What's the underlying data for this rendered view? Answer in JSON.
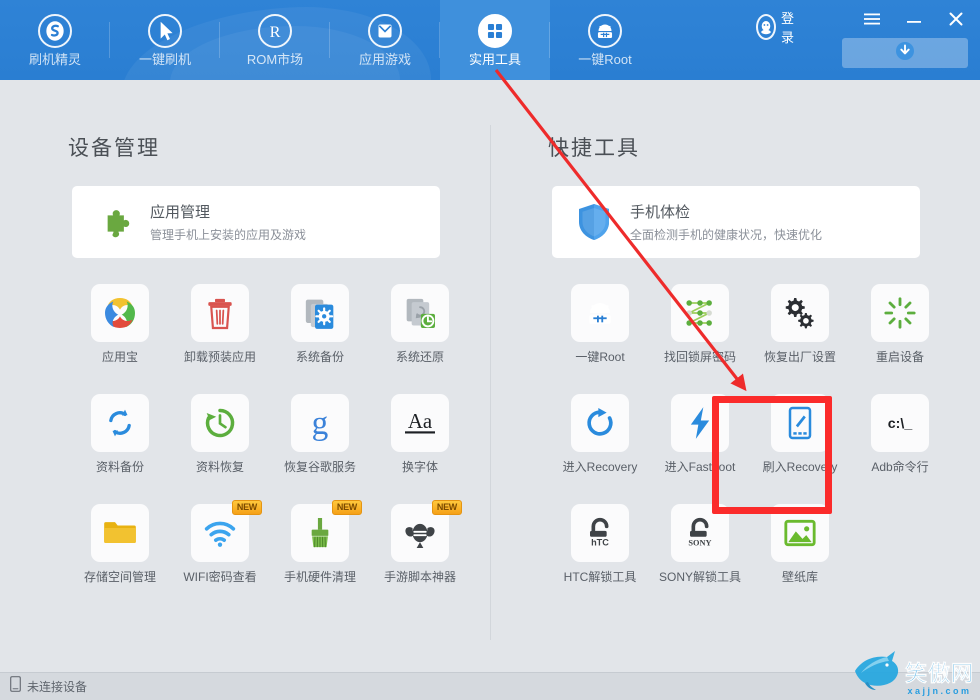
{
  "header": {
    "nav": [
      {
        "label": "刷机精灵",
        "icon": "flash-genie-icon",
        "active": false
      },
      {
        "label": "一键刷机",
        "icon": "cursor-arrow-icon",
        "active": false
      },
      {
        "label": "ROM市场",
        "icon": "rom-market-icon",
        "active": false
      },
      {
        "label": "应用游戏",
        "icon": "app-game-icon",
        "active": false
      },
      {
        "label": "实用工具",
        "icon": "grid-tools-icon",
        "active": true
      },
      {
        "label": "一键Root",
        "icon": "android-root-icon",
        "active": false
      }
    ],
    "login_label": "登录",
    "login_icon": "penguin-avatar-icon",
    "menu_icon": "hamburger-menu-icon",
    "minimize_icon": "minimize-icon",
    "close_icon": "close-icon",
    "download_icon": "download-arrow-icon"
  },
  "left": {
    "section_title": "设备管理",
    "feature": {
      "title": "应用管理",
      "subtitle": "管理手机上安装的应用及游戏",
      "icon": "puzzle-piece-icon"
    },
    "tiles": [
      {
        "label": "应用宝",
        "icon": "yingyongbao-icon",
        "new": false
      },
      {
        "label": "卸载预装应用",
        "icon": "trash-can-icon",
        "new": false
      },
      {
        "label": "系统备份",
        "icon": "system-backup-icon",
        "new": false
      },
      {
        "label": "系统还原",
        "icon": "system-restore-icon",
        "new": false
      },
      {
        "label": "资料备份",
        "icon": "data-backup-sync-icon",
        "new": false
      },
      {
        "label": "资料恢复",
        "icon": "data-restore-clock-icon",
        "new": false
      },
      {
        "label": "恢复谷歌服务",
        "icon": "google-g-icon",
        "new": false
      },
      {
        "label": "换字体",
        "icon": "font-aa-icon",
        "new": false
      },
      {
        "label": "存储空间管理",
        "icon": "folder-icon",
        "new": false
      },
      {
        "label": "WIFI密码查看",
        "icon": "wifi-icon",
        "new": true
      },
      {
        "label": "手机硬件清理",
        "icon": "broom-icon",
        "new": true
      },
      {
        "label": "手游脚本神器",
        "icon": "script-bug-icon",
        "new": true
      }
    ]
  },
  "right": {
    "section_title": "快捷工具",
    "feature": {
      "title": "手机体检",
      "subtitle": "全面检测手机的健康状况，快速优化",
      "icon": "shield-icon"
    },
    "tiles": [
      {
        "label": "一键Root",
        "icon": "android-root-icon",
        "new": false
      },
      {
        "label": "找回锁屏密码",
        "icon": "pattern-lock-icon",
        "new": false
      },
      {
        "label": "恢复出厂设置",
        "icon": "gears-icon",
        "new": false
      },
      {
        "label": "重启设备",
        "icon": "restart-burst-icon",
        "new": false
      },
      {
        "label": "进入Recovery",
        "icon": "refresh-circle-icon",
        "new": false
      },
      {
        "label": "进入Fastboot",
        "icon": "lightning-bolt-icon",
        "new": false
      },
      {
        "label": "刷入Recovery",
        "icon": "phone-pencil-icon",
        "new": false,
        "highlighted": true
      },
      {
        "label": "Adb命令行",
        "icon": "command-prompt-icon",
        "new": false
      },
      {
        "label": "HTC解锁工具",
        "icon": "htc-unlock-icon",
        "new": false
      },
      {
        "label": "SONY解锁工具",
        "icon": "sony-unlock-icon",
        "new": false
      },
      {
        "label": "壁纸库",
        "icon": "wallpaper-image-icon",
        "new": false
      }
    ]
  },
  "statusbar": {
    "text": "未连接设备",
    "icon": "phone-outline-icon"
  },
  "watermark": {
    "name": "笑傲网",
    "url": "xajjn.com",
    "icon": "shark-logo-icon"
  },
  "annotations": {
    "highlight_color": "#fb2b2b",
    "arrow_color": "#ee2b2b",
    "arrow_from": "实用工具",
    "arrow_to": "刷入Recovery"
  },
  "colors": {
    "header_blue": "#2a7fd4",
    "active_blue": "#3f90dc",
    "page_bg": "#e2e5e9",
    "card_white": "#ffffff",
    "badge_orange": "#f5a018"
  }
}
